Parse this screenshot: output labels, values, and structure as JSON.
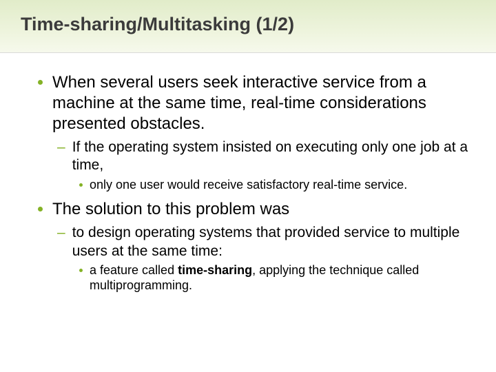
{
  "title": "Time-sharing/Multitasking (1/2)",
  "p1": {
    "text": "When several users seek interactive service from a machine at the same time, real-time considerations presented obstacles.",
    "sub": {
      "text": "If the operating system insisted on executing only one job at a time,",
      "sub": {
        "text": "only one user would receive satisfactory real-time service."
      }
    }
  },
  "p2": {
    "text": "The solution to this problem was",
    "sub": {
      "text": "to design operating systems that provided service to multiple users at the same time:",
      "sub": {
        "prefix": "a feature called ",
        "bold": "time-sharing",
        "suffix": ", applying the technique called multiprogramming."
      }
    }
  }
}
